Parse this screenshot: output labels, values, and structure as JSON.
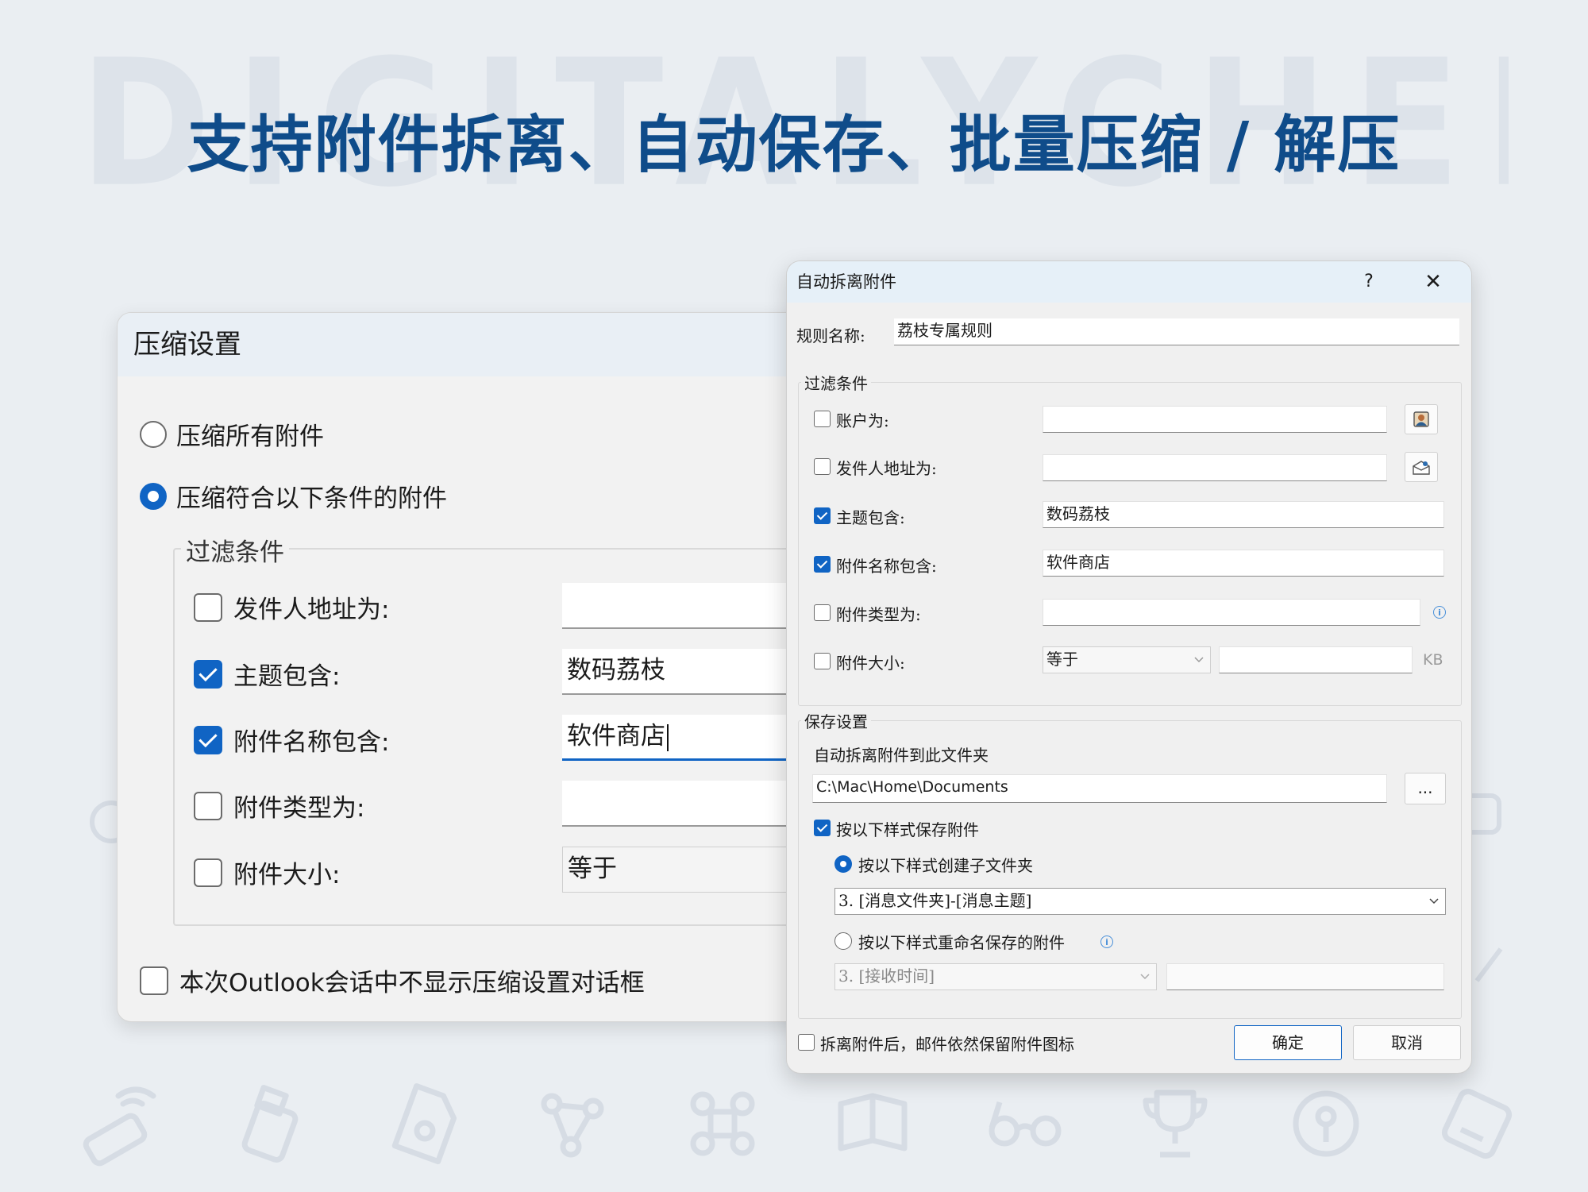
{
  "banner": {
    "watermark": "DIGITALYCHEE",
    "headline": "支持附件拆离、自动保存、批量压缩 / 解压"
  },
  "compress_dialog": {
    "title": "压缩设置",
    "option_all": "压缩所有附件",
    "option_conditional": "压缩符合以下条件的附件",
    "selected_option": "option_conditional",
    "filter_group": "过滤条件",
    "filters": {
      "sender_label": "发件人地址为:",
      "sender_value": "",
      "sender_checked": false,
      "subject_label": "主题包含:",
      "subject_value": "数码荔枝",
      "subject_checked": true,
      "attachment_name_label": "附件名称包含:",
      "attachment_name_value": "软件商店",
      "attachment_name_checked": true,
      "attachment_type_label": "附件类型为:",
      "attachment_type_value": "",
      "attachment_type_checked": false,
      "attachment_size_label": "附件大小:",
      "attachment_size_operator": "等于",
      "attachment_size_checked": false
    },
    "dont_show_label": "本次Outlook会话中不显示压缩设置对话框",
    "dont_show_checked": false
  },
  "detach_dialog": {
    "title": "自动拆离附件",
    "help": "?",
    "close": "✕",
    "rule_name_label": "规则名称:",
    "rule_name_value": "荔枝专属规则",
    "filter_group": "过滤条件",
    "filters": {
      "account_label": "账户为:",
      "account_value": "",
      "account_checked": false,
      "sender_label": "发件人地址为:",
      "sender_value": "",
      "sender_checked": false,
      "subject_label": "主题包含:",
      "subject_value": "数码荔枝",
      "subject_checked": true,
      "attachment_name_label": "附件名称包含:",
      "attachment_name_value": "软件商店",
      "attachment_name_checked": true,
      "attachment_type_label": "附件类型为:",
      "attachment_type_value": "",
      "attachment_type_checked": false,
      "attachment_size_label": "附件大小:",
      "attachment_size_operator": "等于",
      "attachment_size_value": "",
      "attachment_size_unit": "KB",
      "attachment_size_checked": false
    },
    "save_group": "保存设置",
    "folder_label": "自动拆离附件到此文件夹",
    "folder_value": "C:\\Mac\\Home\\Documents",
    "browse_label": "...",
    "save_style_label": "按以下样式保存附件",
    "save_style_checked": true,
    "create_subfolder_label": "按以下样式创建子文件夹",
    "subfolder_pattern": "3. [消息文件夹]-[消息主题]",
    "rename_label": "按以下样式重命名保存的附件",
    "rename_pattern": "3. [接收时间]",
    "rename_suffix": "",
    "selected_style": "create_subfolder",
    "keep_icon_label": "拆离附件后，邮件依然保留附件图标",
    "keep_icon_checked": false,
    "ok_label": "确定",
    "cancel_label": "取消"
  },
  "colors": {
    "accent": "#1064c4",
    "headline": "#0f4c8a",
    "background": "#eaeef2",
    "dialog_bg": "#f0f0f0",
    "titlebar_bg": "#e6f0f8"
  },
  "icons": [
    "address-book-icon",
    "envelope-person-icon",
    "info-icon",
    "chevron-down-icon",
    "close-icon"
  ]
}
